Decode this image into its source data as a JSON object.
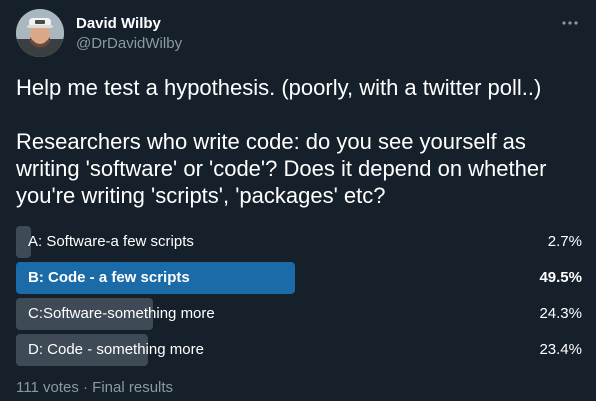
{
  "author": {
    "display_name": "David Wilby",
    "handle": "@DrDavidWilby",
    "avatar_icon": "avatar-photo-icon"
  },
  "tweet": {
    "text": "Help me test a hypothesis. (poorly, with a twitter poll..)\n\nResearchers who write code: do you see yourself as writing 'software' or 'code'? Does it depend on whether you're writing 'scripts', 'packages' etc?"
  },
  "poll": {
    "options": [
      {
        "label": "A: Software-a few scripts",
        "percent": "2.7%",
        "value": 2.7,
        "winner": false
      },
      {
        "label": "B: Code - a few scripts",
        "percent": "49.5%",
        "value": 49.5,
        "winner": true
      },
      {
        "label": "C:Software-something more",
        "percent": "24.3%",
        "value": 24.3,
        "winner": false
      },
      {
        "label": "D: Code - something more",
        "percent": "23.4%",
        "value": 23.4,
        "winner": false
      }
    ],
    "votes": "111 votes",
    "separator": "·",
    "status": "Final results"
  },
  "colors": {
    "background": "#15202b",
    "winner_bar": "#1a6ba8",
    "bar": "#3e4a55",
    "muted_text": "#8b98a5"
  }
}
